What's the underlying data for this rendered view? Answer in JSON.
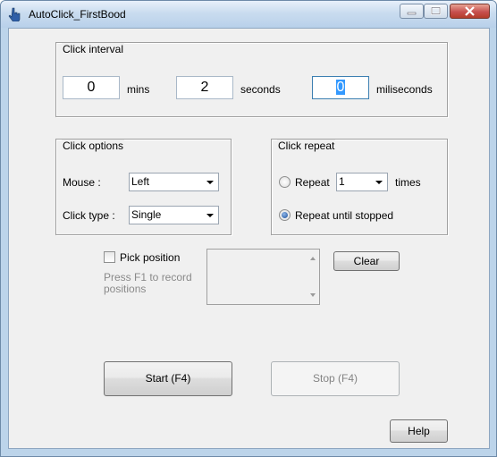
{
  "window": {
    "title": "AutoClick_FirstBood"
  },
  "click_interval": {
    "group_label": "Click interval",
    "mins_value": "0",
    "mins_label": "mins",
    "seconds_value": "2",
    "seconds_label": "seconds",
    "ms_value": "0",
    "ms_label": "miliseconds"
  },
  "click_options": {
    "group_label": "Click options",
    "mouse_label": "Mouse :",
    "mouse_value": "Left",
    "type_label": "Click type :",
    "type_value": "Single"
  },
  "click_repeat": {
    "group_label": "Click repeat",
    "repeat_label": "Repeat",
    "repeat_count": "1",
    "times_label": "times",
    "until_stopped_label": "Repeat until stopped",
    "selected": "until_stopped"
  },
  "position": {
    "pick_label": "Pick position",
    "pick_checked": false,
    "hint_line1": "Press F1 to record",
    "hint_line2": "positions",
    "clear_label": "Clear"
  },
  "actions": {
    "start_label": "Start (F4)",
    "stop_label": "Stop (F4)",
    "help_label": "Help"
  },
  "icons": [
    "app-hand-icon",
    "minimize-icon",
    "maximize-icon",
    "close-icon",
    "dropdown-arrow-icon",
    "scroll-up-icon",
    "scroll-down-icon"
  ]
}
